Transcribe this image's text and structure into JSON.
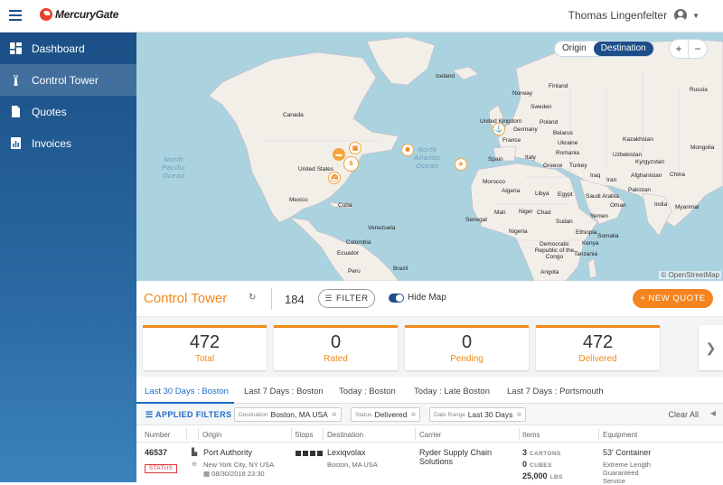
{
  "header": {
    "brand": "MercuryGate",
    "user_name": "Thomas Lingenfelter"
  },
  "sidebar": {
    "items": [
      {
        "label": "Dashboard",
        "icon": "dashboard-icon"
      },
      {
        "label": "Control Tower",
        "icon": "tower-icon",
        "active": true
      },
      {
        "label": "Quotes",
        "icon": "document-icon"
      },
      {
        "label": "Invoices",
        "icon": "invoice-chart-icon"
      }
    ]
  },
  "map": {
    "toggle": {
      "origin": "Origin",
      "destination": "Destination",
      "selected": "Destination"
    },
    "zoom_in": "+",
    "zoom_out": "−",
    "attribution": "© OpenStreetMap",
    "oceans": {
      "north_pacific": "North\nPacific\nOcean",
      "north_atlantic": "North\nAtlantic\nOcean"
    },
    "labels": [
      "Iceland",
      "Norway",
      "Sweden",
      "Finland",
      "Russia",
      "Canada",
      "United Kingdom",
      "Germany",
      "Poland",
      "Belarus",
      "France",
      "Ukraine",
      "Kazakhstan",
      "Mongolia",
      "Spain",
      "Italy",
      "Romania",
      "Turkey",
      "Greece",
      "Uzbekistan",
      "Kyrgyzstan",
      "China",
      "United States",
      "Morocco",
      "Algeria",
      "Libya",
      "Egypt",
      "Iraq",
      "Iran",
      "Afghanistan",
      "Pakistan",
      "Saudi Arabia",
      "India",
      "Mexico",
      "Cuba",
      "Mali",
      "Niger",
      "Chad",
      "Sudan",
      "Yemen",
      "Oman",
      "Senegal",
      "Nigeria",
      "Ethiopia",
      "Venezuela",
      "Colombia",
      "Ecuador",
      "Peru",
      "Brazil",
      "Democratic Republic of the Congo",
      "Tanzania",
      "Angola",
      "Kenya",
      "Myanmar",
      "Somalia"
    ],
    "cluster_count": "8",
    "markers": [
      "truck-marker-icon",
      "bus-marker-icon",
      "cluster-marker",
      "ship-marker-icon",
      "gear-marker-icon",
      "plane-marker-icon",
      "rail-marker-icon"
    ]
  },
  "control_tower": {
    "title": "Control Tower",
    "count": "184",
    "filter_label": "FILTER",
    "hide_map_label": "Hide Map",
    "new_quote_label": "+ NEW QUOTE"
  },
  "stats": [
    {
      "value": "472",
      "label": "Total"
    },
    {
      "value": "0",
      "label": "Rated"
    },
    {
      "value": "0",
      "label": "Pending"
    },
    {
      "value": "472",
      "label": "Delivered"
    }
  ],
  "tabs": [
    "Last 30 Days : Boston",
    "Last 7 Days : Boston",
    "Today : Boston",
    "Today : Late Boston",
    "Last 7 Days : Portsmouth"
  ],
  "filters": {
    "label": "APPLIED FILTERS",
    "chips": [
      {
        "key": "Destination",
        "value": "Boston, MA  USA"
      },
      {
        "key": "Status",
        "value": "Delivered"
      },
      {
        "key": "Date Range",
        "value": "Last 30 Days"
      }
    ],
    "clear_all": "Clear All"
  },
  "table": {
    "columns": [
      "Number",
      "Origin",
      "Stops",
      "Destination",
      "Carrier",
      "Items",
      "Equipment"
    ],
    "rows": [
      {
        "number": "46537",
        "status": "STATUS",
        "origin_name": "Port Authority",
        "origin_city": "New York City, NY  USA",
        "origin_date": "08/30/2018  23:30",
        "destination_name": "Lexiqvolax",
        "destination_city": "Boston, MA  USA",
        "carrier": "Ryder Supply Chain Solutions",
        "items_cartons": "3",
        "unit_cartons": "CARTONS",
        "items_cubes": "0",
        "unit_cubes": "CUBES",
        "items_lbs": "25,000",
        "unit_lbs": "LBS",
        "equipment": "53' Container",
        "equipment_note": "Extreme Length\nGuaranteed\nService"
      }
    ]
  },
  "colors": {
    "accent": "#f08a1a",
    "primary": "#1d4e89",
    "water": "#aad3df",
    "land": "#f2efe9"
  }
}
